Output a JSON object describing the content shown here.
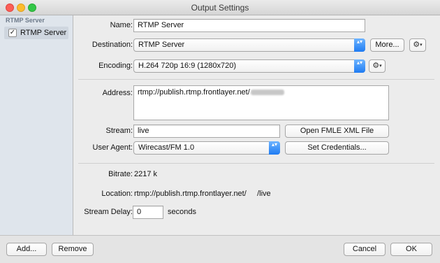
{
  "window": {
    "title": "Output Settings"
  },
  "sidebar": {
    "header": "RTMP Server",
    "items": [
      {
        "label": "RTMP Server",
        "checked": true,
        "check_glyph": "✓"
      }
    ]
  },
  "form": {
    "name_label": "Name:",
    "name_value": "RTMP Server",
    "destination_label": "Destination:",
    "destination_value": "RTMP Server",
    "more_button": "More...",
    "encoding_label": "Encoding:",
    "encoding_value": "H.264 720p 16:9 (1280x720)",
    "address_label": "Address:",
    "address_value": "rtmp://publish.rtmp.frontlayer.net/",
    "stream_label": "Stream:",
    "stream_value": "live",
    "open_fmle_button": "Open FMLE XML File",
    "user_agent_label": "User Agent:",
    "user_agent_value": "Wirecast/FM 1.0",
    "set_credentials_button": "Set Credentials...",
    "bitrate_label": "Bitrate:",
    "bitrate_value": "2217 k",
    "location_label": "Location:",
    "location_value": "rtmp://publish.rtmp.frontlayer.net/     /live",
    "stream_delay_label": "Stream Delay:",
    "stream_delay_value": "0",
    "stream_delay_unit": "seconds"
  },
  "footer": {
    "add_button": "Add...",
    "remove_button": "Remove",
    "cancel_button": "Cancel",
    "ok_button": "OK"
  },
  "icons": {
    "gear": "⚙",
    "caret": "▾",
    "popup_arrows": "▴▾"
  },
  "colors": {
    "accent": "#1f7bf2",
    "sidebar_bg": "#dfe5ec",
    "window_bg": "#ececec"
  }
}
